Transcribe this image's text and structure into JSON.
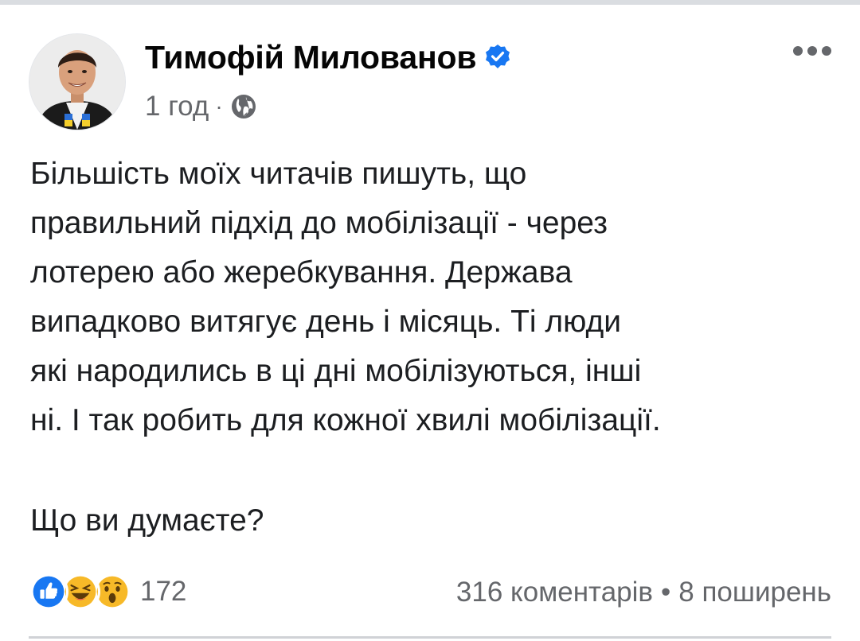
{
  "post": {
    "author": "Тимофій Милованов",
    "time": "1 год",
    "separator": "·",
    "body_lines": [
      "Більшість моїх читачів пишуть, що",
      "правильний підхід до мобілізації - через",
      "лотерею або жеребкування. Держава",
      "випадково витягує день і місяць. Ті люди",
      "які народились в ці дні мобілізуються, інші",
      "ні. І так робить для кожної хвилі мобілізації."
    ],
    "question": "Що ви думаєте?"
  },
  "icons": {
    "verified": "verified-badge-icon",
    "audience": "globe-icon",
    "more": "more-options-icon",
    "reactions": [
      "like-reaction-icon",
      "haha-reaction-icon",
      "wow-reaction-icon"
    ]
  },
  "reactions": {
    "count": "172"
  },
  "engagement": {
    "comments": "316 коментарів",
    "dot": "•",
    "shares": "8 поширень"
  },
  "colors": {
    "accent": "#1877f2",
    "secondary_text": "#65676b",
    "reaction_yellow": "#f7b928"
  }
}
